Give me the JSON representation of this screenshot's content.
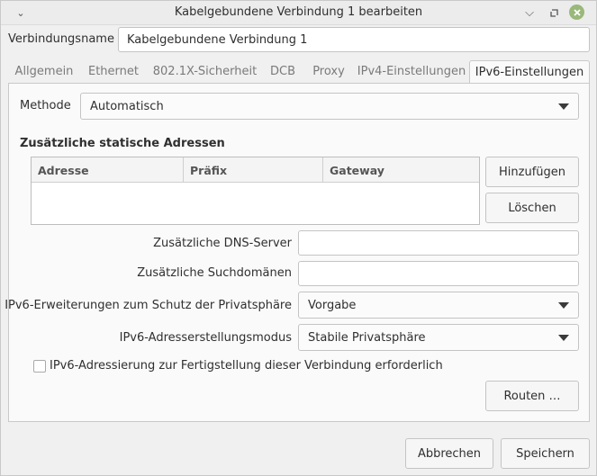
{
  "window": {
    "title": "Kabelgebundene Verbindung 1 bearbeiten",
    "controls": {
      "menu_icon": "chevron-down-icon",
      "minimize_icon": "minimize-icon",
      "maximize_icon": "maximize-icon",
      "close_icon": "close-icon",
      "close_color": "#9ab87a"
    }
  },
  "connection_name": {
    "label": "Verbindungsname",
    "value": "Kabelgebundene Verbindung 1"
  },
  "tabs": [
    {
      "label": "Allgemein",
      "active": false
    },
    {
      "label": "Ethernet",
      "active": false
    },
    {
      "label": "802.1X-Sicherheit",
      "active": false
    },
    {
      "label": "DCB",
      "active": false
    },
    {
      "label": "Proxy",
      "active": false
    },
    {
      "label": "IPv4-Einstellungen",
      "active": false
    },
    {
      "label": "IPv6-Einstellungen",
      "active": true
    }
  ],
  "ipv6": {
    "method": {
      "label": "Methode",
      "value": "Automatisch"
    },
    "static_addresses": {
      "heading": "Zusätzliche statische Adressen",
      "columns": [
        "Adresse",
        "Präfix",
        "Gateway"
      ],
      "rows": [],
      "add_button": "Hinzufügen",
      "delete_button": "Löschen"
    },
    "dns": {
      "label": "Zusätzliche DNS-Server",
      "value": ""
    },
    "search_domains": {
      "label": "Zusätzliche Suchdomänen",
      "value": ""
    },
    "privacy": {
      "label": "IPv6-Erweiterungen zum Schutz der Privatsphäre",
      "value": "Vorgabe"
    },
    "addr_gen_mode": {
      "label": "IPv6-Adresserstellungsmodus",
      "value": "Stabile Privatsphäre"
    },
    "required_checkbox": {
      "label": "IPv6-Adressierung zur Fertigstellung dieser Verbindung erforderlich",
      "checked": false
    },
    "routes_button": "Routen …"
  },
  "footer": {
    "cancel_button": "Abbrechen",
    "save_button": "Speichern"
  }
}
